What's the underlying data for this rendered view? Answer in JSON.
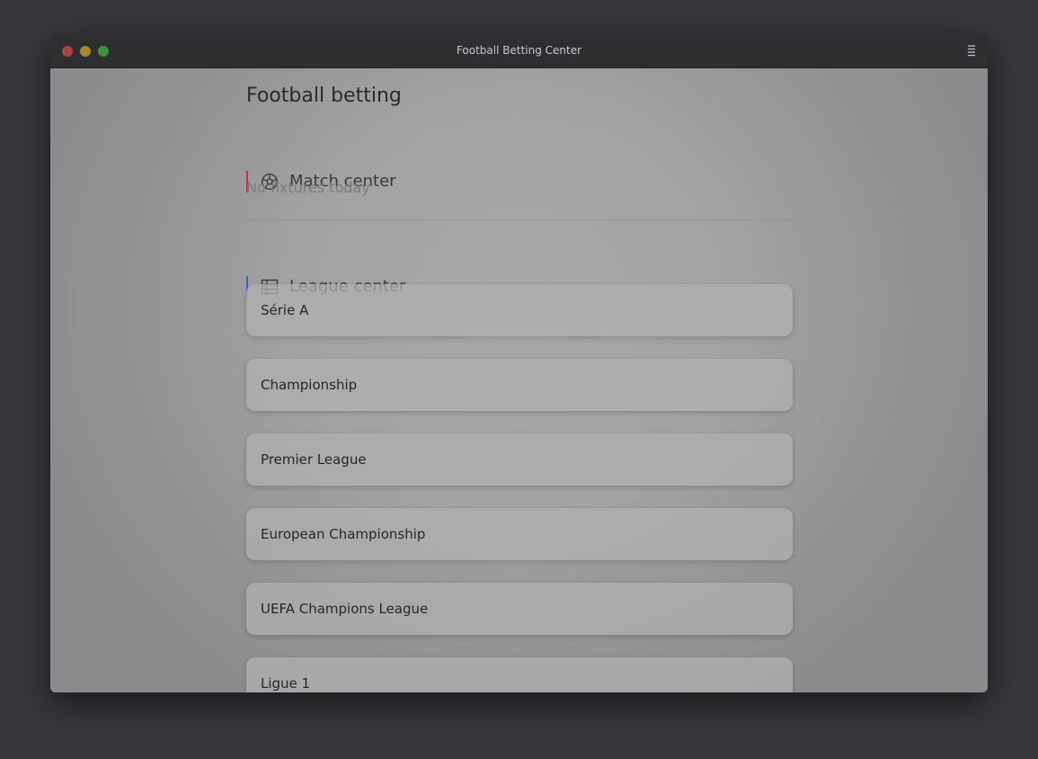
{
  "window": {
    "title": "Football Betting Center"
  },
  "page": {
    "title": "Football betting"
  },
  "match_center": {
    "label": "Match center",
    "icon": "soccer-ball-icon",
    "accent_color": "#b23a44",
    "empty_text": "No fixtures today"
  },
  "league_center": {
    "label": "League center",
    "icon": "table-icon",
    "accent_color": "#4a5fb8",
    "leagues": [
      {
        "name": "Série A"
      },
      {
        "name": "Championship"
      },
      {
        "name": "Premier League"
      },
      {
        "name": "European Championship"
      },
      {
        "name": "UEFA Champions League"
      },
      {
        "name": "Ligue 1"
      }
    ]
  }
}
